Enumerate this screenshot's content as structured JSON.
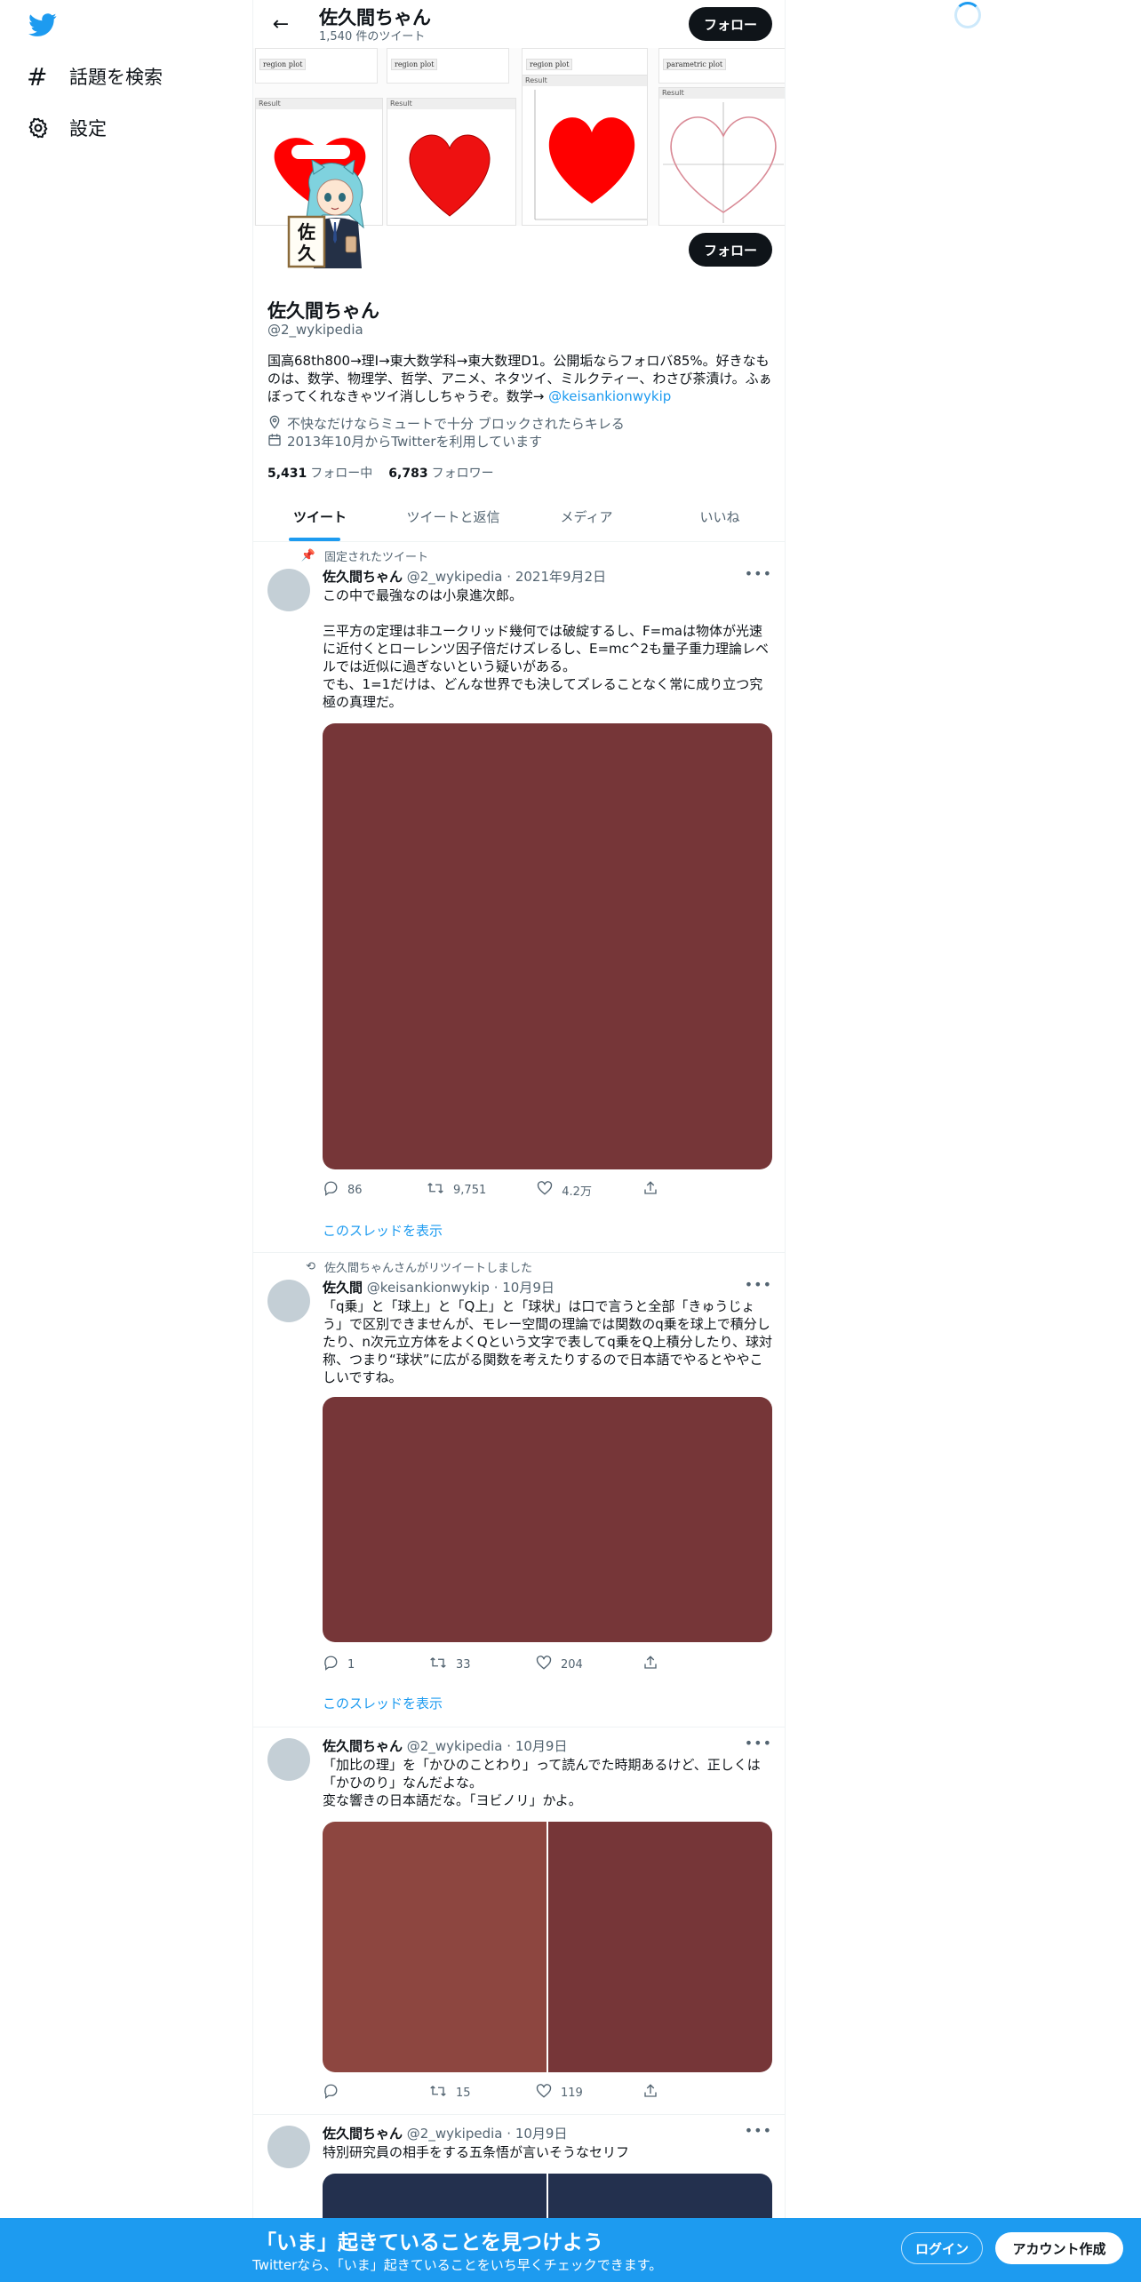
{
  "sidebar": {
    "logo": "twitter-bird-icon",
    "items": [
      {
        "icon": "hashtag-icon",
        "label": "話題を検索"
      },
      {
        "icon": "gear-icon",
        "label": "設定"
      }
    ]
  },
  "header": {
    "title": "佐久間ちゃん",
    "tweet_count": "1,540 件のツイート",
    "follow_label": "フォロー"
  },
  "banner": {
    "formulas": [
      {
        "tag": "region plot"
      },
      {
        "tag": "region plot"
      },
      {
        "tag": "region plot"
      },
      {
        "tag": "parametric plot"
      }
    ],
    "result_label": "Result",
    "avatar_sign": "佐久"
  },
  "profile": {
    "name": "佐久間ちゃん",
    "handle": "@2_wykipedia",
    "follow_label": "フォロー",
    "bio_text": "国高68th800→理Ⅰ→東大数学科→東大数理D1。公開垢ならフォロバ85%。好きなものは、数学、物理学、哲学、アニメ、ネタツイ、ミルクティー、わさび茶漬け。ふぁぼってくれなきゃツイ消ししちゃうぞ。数学→ ",
    "bio_mention": "@keisankionwykip",
    "location": "不快なだけならミュートで十分 ブロックされたらキレる",
    "joined": "2013年10月からTwitterを利用しています",
    "following_count": "5,431",
    "following_label": "フォロー中",
    "followers_count": "6,783",
    "followers_label": "フォロワー"
  },
  "tabs": [
    {
      "label": "ツイート",
      "active": true
    },
    {
      "label": "ツイートと返信",
      "active": false
    },
    {
      "label": "メディア",
      "active": false
    },
    {
      "label": "いいね",
      "active": false
    }
  ],
  "tweets": [
    {
      "context": "固定されたツイート",
      "name": "佐久間ちゃん",
      "handle": "@2_wykipedia",
      "date": "2021年9月2日",
      "text": "この中で最強なのは小泉進次郎。\n\n三平方の定理は非ユークリッド幾何では破綻するし、F=maは物体が光速に近付くとローレンツ因子倍だけズレるし、E=mc^2も量子重力理論レベルでは近似に過ぎないという疑いがある。\nでも、1=1だけは、どんな世界でも決してズレることなく常に成り立つ究極の真理だ。",
      "reply": "86",
      "retweet": "9,751",
      "like": "4.2万",
      "thread_label": "このスレッドを表示",
      "media_colors": [
        "#763638"
      ]
    },
    {
      "context": "佐久間ちゃんさんがリツイートしました",
      "name": "佐久間",
      "handle": "@keisankionwykip",
      "date": "10月9日",
      "text": "「q乗」と「球上」と「Q上」と「球状」は口で言うと全部「きゅうじょう」で区別できませんが、モレー空間の理論では関数のq乗を球上で積分したり、n次元立方体をよくQという文字で表してq乗をQ上積分したり、球対称、つまり“球状”に広がる関数を考えたりするので日本語でやるとややこしいですね。",
      "reply": "1",
      "retweet": "33",
      "like": "204",
      "thread_label": "このスレッドを表示",
      "media_colors": [
        "#763638"
      ]
    },
    {
      "context": "",
      "name": "佐久間ちゃん",
      "handle": "@2_wykipedia",
      "date": "10月9日",
      "text": "「加比の理」を「かひのことわり」って読んでた時期あるけど、正しくは「かひのり」なんだよな。\n変な響きの日本語だな。「ヨビノリ」かよ。",
      "reply": "",
      "retweet": "15",
      "like": "119",
      "thread_label": "",
      "media_colors": [
        "#8d4640",
        "#763638"
      ]
    },
    {
      "context": "",
      "name": "佐久間ちゃん",
      "handle": "@2_wykipedia",
      "date": "10月9日",
      "text": "特別研究員の相手をする五条悟が言いそうなセリフ",
      "reply": "",
      "retweet": "",
      "like": "",
      "thread_label": "",
      "media_colors": [
        "#23304e",
        "#23304e"
      ]
    }
  ],
  "bottom_bar": {
    "title": "「いま」起きていることを見つけよう",
    "subtitle": "Twitterなら、「いま」起きていることをいち早くチェックできます。",
    "login_label": "ログイン",
    "signup_label": "アカウント作成"
  },
  "colors": {
    "accent": "#1d9bf0",
    "text": "#0f1419",
    "muted": "#536471",
    "heart_red": "#ff0000"
  }
}
